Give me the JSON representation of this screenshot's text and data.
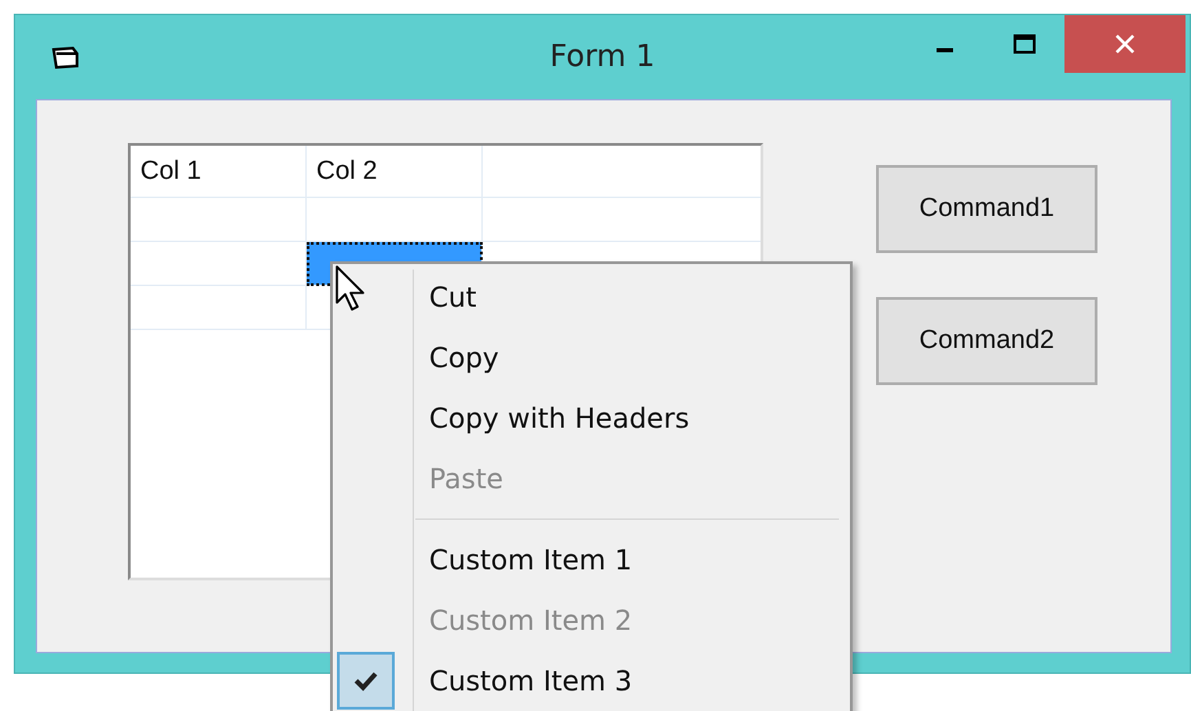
{
  "window": {
    "title": "Form 1"
  },
  "grid": {
    "columns": [
      "Col 1",
      "Col 2"
    ],
    "rows": [
      {
        "selected": false
      },
      {
        "selected": true
      },
      {
        "selected": false
      }
    ]
  },
  "buttons": [
    "Command1",
    "Command2"
  ],
  "context_menu": [
    {
      "kind": "item",
      "label": "Cut",
      "disabled": false,
      "checked": false
    },
    {
      "kind": "item",
      "label": "Copy",
      "disabled": false,
      "checked": false
    },
    {
      "kind": "item",
      "label": "Copy with Headers",
      "disabled": false,
      "checked": false
    },
    {
      "kind": "item",
      "label": "Paste",
      "disabled": true,
      "checked": false
    },
    {
      "kind": "separator"
    },
    {
      "kind": "item",
      "label": "Custom Item 1",
      "disabled": false,
      "checked": false
    },
    {
      "kind": "item",
      "label": "Custom Item 2",
      "disabled": true,
      "checked": false
    },
    {
      "kind": "item",
      "label": "Custom Item 3",
      "disabled": false,
      "checked": true
    }
  ]
}
